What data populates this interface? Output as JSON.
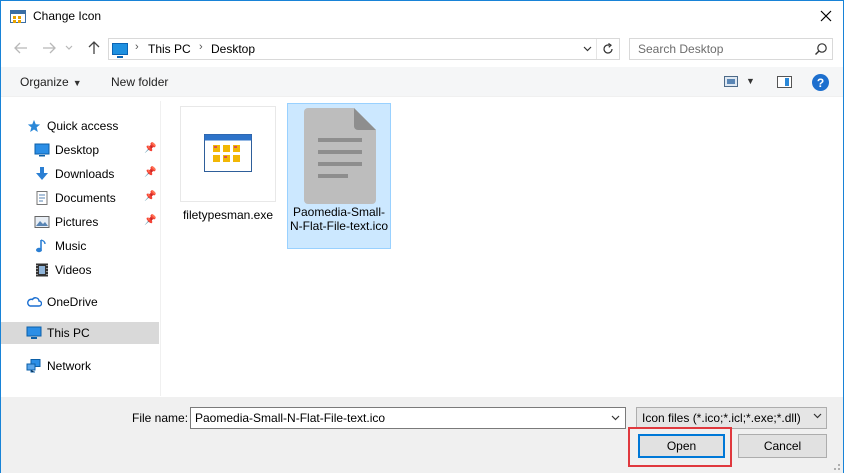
{
  "window": {
    "title": "Change Icon"
  },
  "nav": {
    "crumbs": [
      "This PC",
      "Desktop"
    ],
    "search_placeholder": "Search Desktop"
  },
  "toolbar": {
    "organize": "Organize",
    "new_folder": "New folder"
  },
  "sidebar": {
    "items": [
      {
        "label": "Quick access"
      },
      {
        "label": "Desktop"
      },
      {
        "label": "Downloads"
      },
      {
        "label": "Documents"
      },
      {
        "label": "Pictures"
      },
      {
        "label": "Music"
      },
      {
        "label": "Videos"
      },
      {
        "label": "OneDrive"
      },
      {
        "label": "This PC"
      },
      {
        "label": "Network"
      }
    ],
    "selected": "This PC"
  },
  "files": [
    {
      "name": "filetypesman.exe"
    },
    {
      "name": "Paomedia-Small-N-Flat-File-text.ico",
      "selected": true
    }
  ],
  "footer": {
    "filename_label": "File name:",
    "filename_value": "Paomedia-Small-N-Flat-File-text.ico",
    "filetype": "Icon files (*.ico;*.icl;*.exe;*.dll)",
    "open_label": "Open",
    "cancel_label": "Cancel"
  },
  "colors": {
    "accent": "#0078d7",
    "selection": "#cce8ff",
    "highlight": "#e0393e"
  }
}
